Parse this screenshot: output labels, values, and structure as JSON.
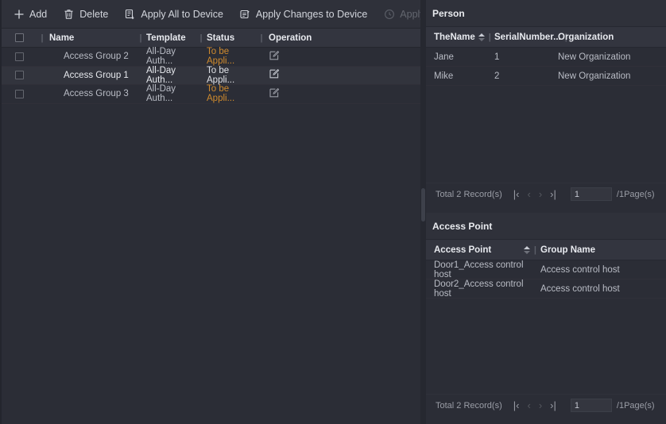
{
  "colors": {
    "app_bg": "#2b2d36",
    "panel_header_bg": "#2f313a",
    "table_header_bg": "#33353f",
    "row_alt_bg": "#303239",
    "row_selected_bg": "#32343d",
    "text_primary": "#e8eaef",
    "text_secondary": "#b9bcc5",
    "text_disabled": "#63666f",
    "status_warning": "#cf8a2d",
    "splitter": "#3d404a"
  },
  "toolbar": {
    "items": [
      {
        "label": "Add",
        "icon": "plus-icon",
        "disabled": false
      },
      {
        "label": "Delete",
        "icon": "trash-icon",
        "disabled": false
      },
      {
        "label": "Apply All to Device",
        "icon": "apply-all-icon",
        "disabled": false
      },
      {
        "label": "Apply Changes to Device",
        "icon": "apply-changes-icon",
        "disabled": false
      },
      {
        "label": "Applying Status",
        "icon": "clock-icon",
        "disabled": true
      }
    ]
  },
  "access_group_table": {
    "columns": [
      "",
      "Name",
      "Template",
      "Status",
      "Operation"
    ],
    "rows": [
      {
        "name": "Access Group 2",
        "template": "All-Day Auth...",
        "status": "To be Appli...",
        "operation": "edit-icon",
        "selected": false
      },
      {
        "name": "Access Group 1",
        "template": "All-Day Auth...",
        "status": "To be Appli...",
        "operation": "edit-icon",
        "selected": true
      },
      {
        "name": "Access Group 3",
        "template": "All-Day Auth...",
        "status": "To be Appli...",
        "operation": "edit-icon",
        "selected": false
      }
    ]
  },
  "person_panel": {
    "title": "Person",
    "columns": [
      "TheName",
      "SerialNumber...",
      "Organization"
    ],
    "rows": [
      {
        "name": "Jane",
        "serial": "1",
        "organization": "New Organization"
      },
      {
        "name": "Mike",
        "serial": "2",
        "organization": "New Organization"
      }
    ],
    "pager": {
      "total_label": "Total 2 Record(s)",
      "page_value": "1",
      "page_total_label": "/1Page(s)",
      "first": "|‹",
      "prev": "‹",
      "next": "›",
      "last": "›|"
    }
  },
  "access_point_panel": {
    "title": "Access Point",
    "columns": [
      "Access Point",
      "Group Name"
    ],
    "rows": [
      {
        "access_point": "Door1_Access control host",
        "group_name": "Access control host"
      },
      {
        "access_point": "Door2_Access control host",
        "group_name": "Access control host"
      }
    ],
    "pager": {
      "total_label": "Total 2 Record(s)",
      "page_value": "1",
      "page_total_label": "/1Page(s)",
      "first": "|‹",
      "prev": "‹",
      "next": "›",
      "last": "›|"
    }
  }
}
